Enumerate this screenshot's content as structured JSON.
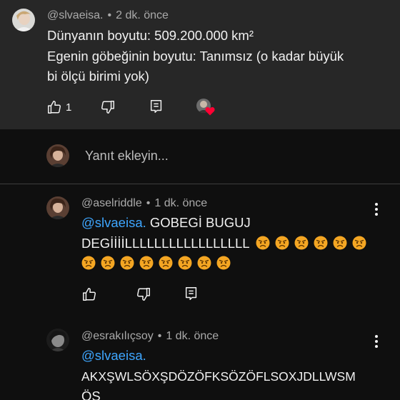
{
  "top_comment": {
    "username": "@slvaeisa.",
    "time": "2 dk. önce",
    "line1": "Dünyanın boyutu: 509.200.000 km²",
    "line2": "Egenin göbeğinin boyutu: Tanımsız (o kadar büyük",
    "line3": "bi ölçü birimi yok)",
    "like_count": "1"
  },
  "reply_box": {
    "placeholder": "Yanıt ekleyin..."
  },
  "replies": [
    {
      "username": "@aselriddle",
      "time": "1 dk. önce",
      "mention": "@slvaeisa.",
      "text1": " GOBEGİ BUGUJ",
      "text2": "DEGİİİİLLLLLLLLLLLLLLLLL"
    },
    {
      "username": "@esrakılıçsoy",
      "time": "1 dk. önce",
      "mention": "@slvaeisa.",
      "text1": "AKXŞWLSÖXŞDÖZÖFKSÖZÖFLSOXJDLLWSM",
      "text2": "ÖS"
    }
  ],
  "icons": {
    "like": "thumbs-up-icon",
    "dislike": "thumbs-down-icon",
    "reply": "reply-icon",
    "more": "more-vertical-icon",
    "emoji": "angry-face-icon",
    "heart": "heart-icon"
  },
  "colors": {
    "mention": "#3ea6ff",
    "heart": "#ff0033",
    "angry_face": "#f4a623"
  }
}
